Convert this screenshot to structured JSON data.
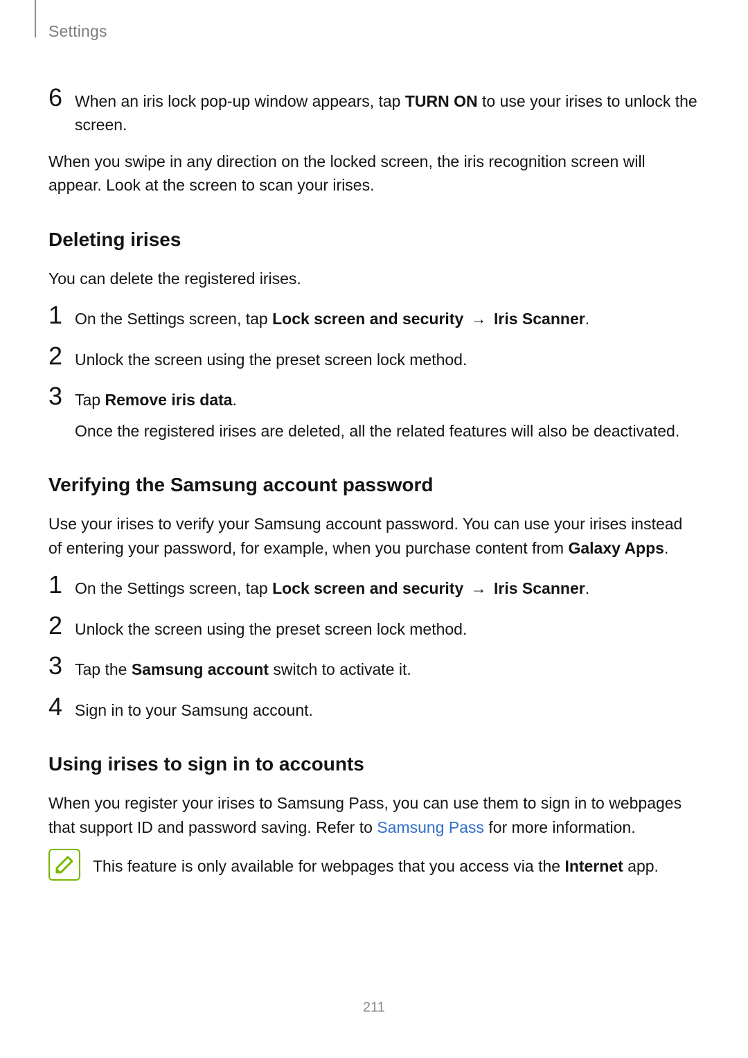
{
  "header": {
    "title": "Settings"
  },
  "step6": {
    "num": "6",
    "pre": "When an iris lock pop-up window appears, tap ",
    "bold": "TURN ON",
    "post": " to use your irises to unlock the screen."
  },
  "intro_after6": "When you swipe in any direction on the locked screen, the iris recognition screen will appear. Look at the screen to scan your irises.",
  "sec_del": {
    "heading": "Deleting irises",
    "intro": "You can delete the registered irises.",
    "s1": {
      "num": "1",
      "pre": "On the Settings screen, tap ",
      "b1": "Lock screen and security",
      "arrow": " → ",
      "b2": "Iris Scanner",
      "post": "."
    },
    "s2": {
      "num": "2",
      "text": "Unlock the screen using the preset screen lock method."
    },
    "s3": {
      "num": "3",
      "pre": "Tap ",
      "b": "Remove iris data",
      "post": ".",
      "sub": "Once the registered irises are deleted, all the related features will also be deactivated."
    }
  },
  "sec_verify": {
    "heading": "Verifying the Samsung account password",
    "intro_pre": "Use your irises to verify your Samsung account password. You can use your irises instead of entering your password, for example, when you purchase content from ",
    "intro_b": "Galaxy Apps",
    "intro_post": ".",
    "s1": {
      "num": "1",
      "pre": "On the Settings screen, tap ",
      "b1": "Lock screen and security",
      "arrow": " → ",
      "b2": "Iris Scanner",
      "post": "."
    },
    "s2": {
      "num": "2",
      "text": "Unlock the screen using the preset screen lock method."
    },
    "s3": {
      "num": "3",
      "pre": "Tap the ",
      "b": "Samsung account",
      "post": " switch to activate it."
    },
    "s4": {
      "num": "4",
      "text": "Sign in to your Samsung account."
    }
  },
  "sec_using": {
    "heading": "Using irises to sign in to accounts",
    "intro_pre": "When you register your irises to Samsung Pass, you can use them to sign in to webpages that support ID and password saving. Refer to ",
    "intro_link": "Samsung Pass",
    "intro_post": " for more information.",
    "note_pre": "This feature is only available for webpages that you access via the ",
    "note_b": "Internet",
    "note_post": " app."
  },
  "page_number": "211"
}
